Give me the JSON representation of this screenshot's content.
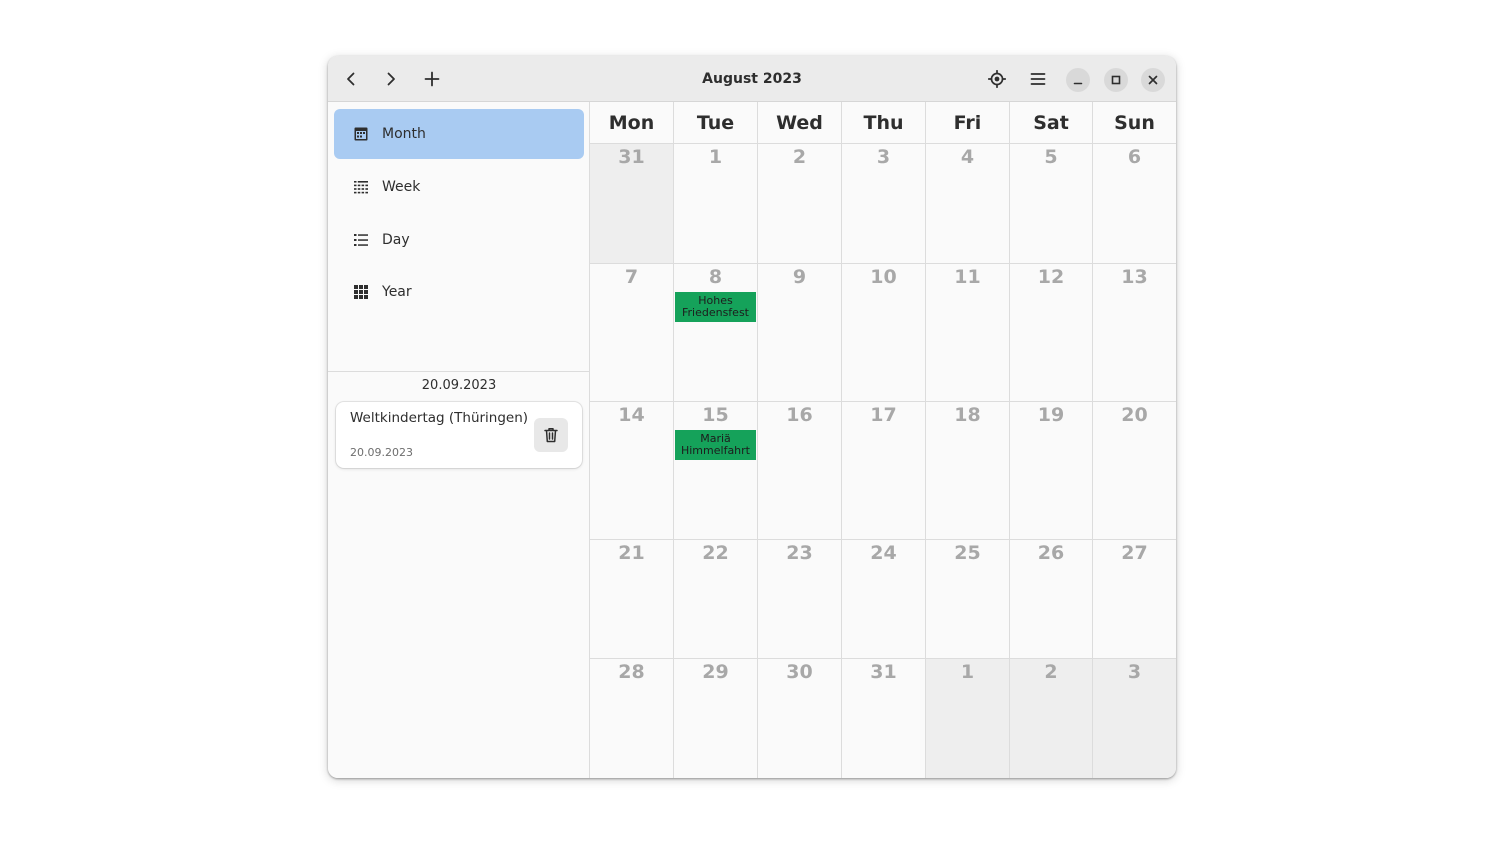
{
  "header": {
    "title": "August 2023",
    "icons": [
      "back-icon",
      "forward-icon",
      "add-icon",
      "locate-icon",
      "hamburger-menu-icon",
      "minimize-icon",
      "maximize-icon",
      "close-icon"
    ]
  },
  "sidebar": {
    "views": [
      {
        "label": "Month",
        "icon": "calendar-month-icon",
        "active": true
      },
      {
        "label": "Week",
        "icon": "calendar-week-icon",
        "active": false
      },
      {
        "label": "Day",
        "icon": "calendar-day-icon",
        "active": false
      },
      {
        "label": "Year",
        "icon": "calendar-year-icon",
        "active": false
      }
    ],
    "selected_date": "20.09.2023",
    "event": {
      "title": "Weltkindertag (Thüringen)",
      "date": "20.09.2023",
      "icon": "trash-icon"
    }
  },
  "calendar": {
    "weekdays": [
      "Mon",
      "Tue",
      "Wed",
      "Thu",
      "Fri",
      "Sat",
      "Sun"
    ],
    "weeks": [
      [
        {
          "d": "31",
          "other": true
        },
        {
          "d": "1"
        },
        {
          "d": "2"
        },
        {
          "d": "3"
        },
        {
          "d": "4"
        },
        {
          "d": "5"
        },
        {
          "d": "6"
        }
      ],
      [
        {
          "d": "7"
        },
        {
          "d": "8",
          "event": "Hohes Friedensfest"
        },
        {
          "d": "9"
        },
        {
          "d": "10"
        },
        {
          "d": "11"
        },
        {
          "d": "12"
        },
        {
          "d": "13"
        }
      ],
      [
        {
          "d": "14"
        },
        {
          "d": "15",
          "event": "Mariä Himmelfahrt"
        },
        {
          "d": "16"
        },
        {
          "d": "17"
        },
        {
          "d": "18"
        },
        {
          "d": "19"
        },
        {
          "d": "20"
        }
      ],
      [
        {
          "d": "21"
        },
        {
          "d": "22"
        },
        {
          "d": "23"
        },
        {
          "d": "24"
        },
        {
          "d": "25"
        },
        {
          "d": "26"
        },
        {
          "d": "27"
        }
      ],
      [
        {
          "d": "28"
        },
        {
          "d": "29"
        },
        {
          "d": "30"
        },
        {
          "d": "31"
        },
        {
          "d": "1",
          "other": true
        },
        {
          "d": "2",
          "other": true
        },
        {
          "d": "3",
          "other": true
        }
      ]
    ],
    "colors": {
      "event": "#15a25a",
      "selection": "#a9cbf2",
      "other_month": "#eeeeee"
    }
  }
}
